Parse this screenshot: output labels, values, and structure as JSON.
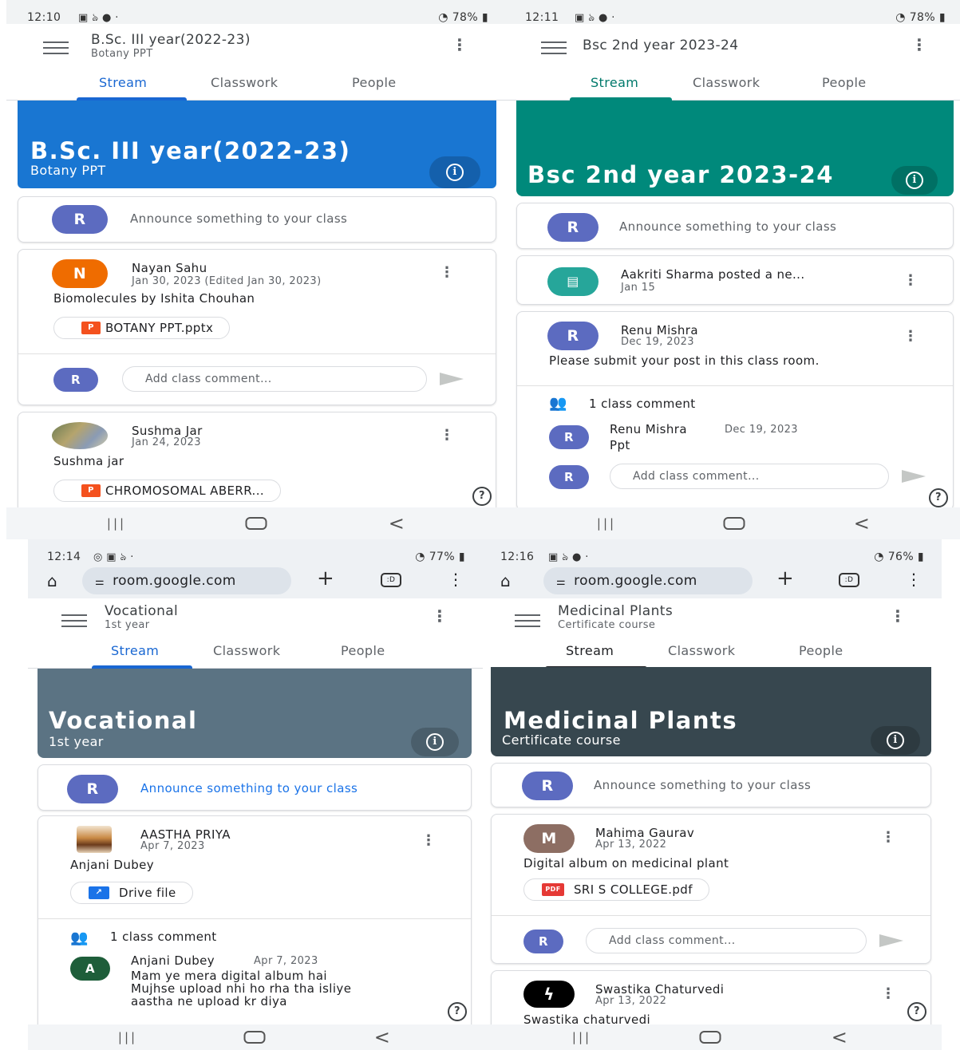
{
  "colors": {
    "blue_banner": "#1976d2",
    "teal_banner": "#00897b",
    "gray_banner": "#5b7383",
    "dark_banner": "#37474f",
    "avatar_r": "#5c6bc0",
    "avatar_n": "#ef6c00",
    "avatar_m": "#8d6e63",
    "avatar_a": "#1e5e3a",
    "assignment": "#26a69a",
    "active_tab": "#1967d2"
  },
  "nav": {
    "recents": "|||",
    "back": "<"
  },
  "phones": [
    {
      "status": {
        "time": "12:10",
        "right": "78%"
      },
      "app_title": "B.Sc. III year(2022-23)",
      "app_subtitle": "Botany PPT",
      "tabs": [
        "Stream",
        "Classwork",
        "People"
      ],
      "banner_title": "B.Sc. III year(2022-23)",
      "banner_subtitle": "Botany PPT",
      "announce_avatar": "R",
      "announce_text": "Announce something to your class",
      "posts": [
        {
          "avatar": "N",
          "author": "Nayan Sahu",
          "date": "Jan 30, 2023 (Edited Jan 30, 2023)",
          "body": "Biomolecules by Ishita Chouhan",
          "file_type": "P",
          "file": "BOTANY PPT.pptx",
          "comment_avatar": "R",
          "comment_placeholder": "Add class comment..."
        },
        {
          "author": "Sushma Jar",
          "date": "Jan 24, 2023",
          "body": "Sushma jar",
          "file_type": "P",
          "file": "CHROMOSOMAL ABERR..."
        }
      ],
      "help": "?"
    },
    {
      "status": {
        "time": "12:11",
        "right": "78%"
      },
      "app_title": "Bsc 2nd year 2023-24",
      "tabs": [
        "Stream",
        "Classwork",
        "People"
      ],
      "banner_title": "Bsc 2nd year 2023-24",
      "announce_avatar": "R",
      "announce_text": "Announce something to your class",
      "assignment": {
        "title": "Aakriti Sharma posted a ne...",
        "date": "Jan 15"
      },
      "post": {
        "avatar": "R",
        "author": "Renu Mishra",
        "date": "Dec 19, 2023",
        "body": "Please submit your post in this class room.",
        "comment_count": "1 class comment",
        "comment": {
          "avatar": "R",
          "author": "Renu Mishra",
          "date": "Dec 19, 2023",
          "text": "Ppt"
        },
        "comment_avatar": "R",
        "comment_placeholder": "Add class comment..."
      },
      "help": "?"
    },
    {
      "status": {
        "time": "12:14",
        "right": "77%"
      },
      "url": "room.google.com",
      "app_title": "Vocational",
      "app_subtitle": "1st year",
      "tabs": [
        "Stream",
        "Classwork",
        "People"
      ],
      "banner_title": "Vocational",
      "banner_subtitle": "1st year",
      "announce_avatar": "R",
      "announce_text": "Announce something to your class",
      "post": {
        "author": "AASTHA PRIYA",
        "date": "Apr 7, 2023",
        "body": "Anjani Dubey",
        "file": "Drive file",
        "comment_count": "1 class comment",
        "comment": {
          "avatar": "A",
          "author": "Anjani Dubey",
          "date": "Apr 7, 2023",
          "lines": [
            "Mam ye mera digital album hai",
            "Mujhse upload nhi ho rha tha isliye",
            "aastha ne upload kr diya"
          ]
        }
      },
      "help": "?"
    },
    {
      "status": {
        "time": "12:16",
        "right": "76%"
      },
      "url": "room.google.com",
      "app_title": "Medicinal Plants",
      "app_subtitle": "Certificate course",
      "tabs": [
        "Stream",
        "Classwork",
        "People"
      ],
      "banner_title": "Medicinal Plants",
      "banner_subtitle": "Certificate course",
      "announce_avatar": "R",
      "announce_text": "Announce something to your class",
      "posts": [
        {
          "avatar": "M",
          "author": "Mahima Gaurav",
          "date": "Apr 13, 2022",
          "body": "Digital album on medicinal plant",
          "file_type": "PDF",
          "file": "SRI S COLLEGE.pdf",
          "comment_avatar": "R",
          "comment_placeholder": "Add class comment..."
        },
        {
          "author": "Swastika Chaturvedi",
          "date": "Apr 13, 2022",
          "body": "Swastika chaturvedi"
        }
      ],
      "help": "?"
    }
  ]
}
